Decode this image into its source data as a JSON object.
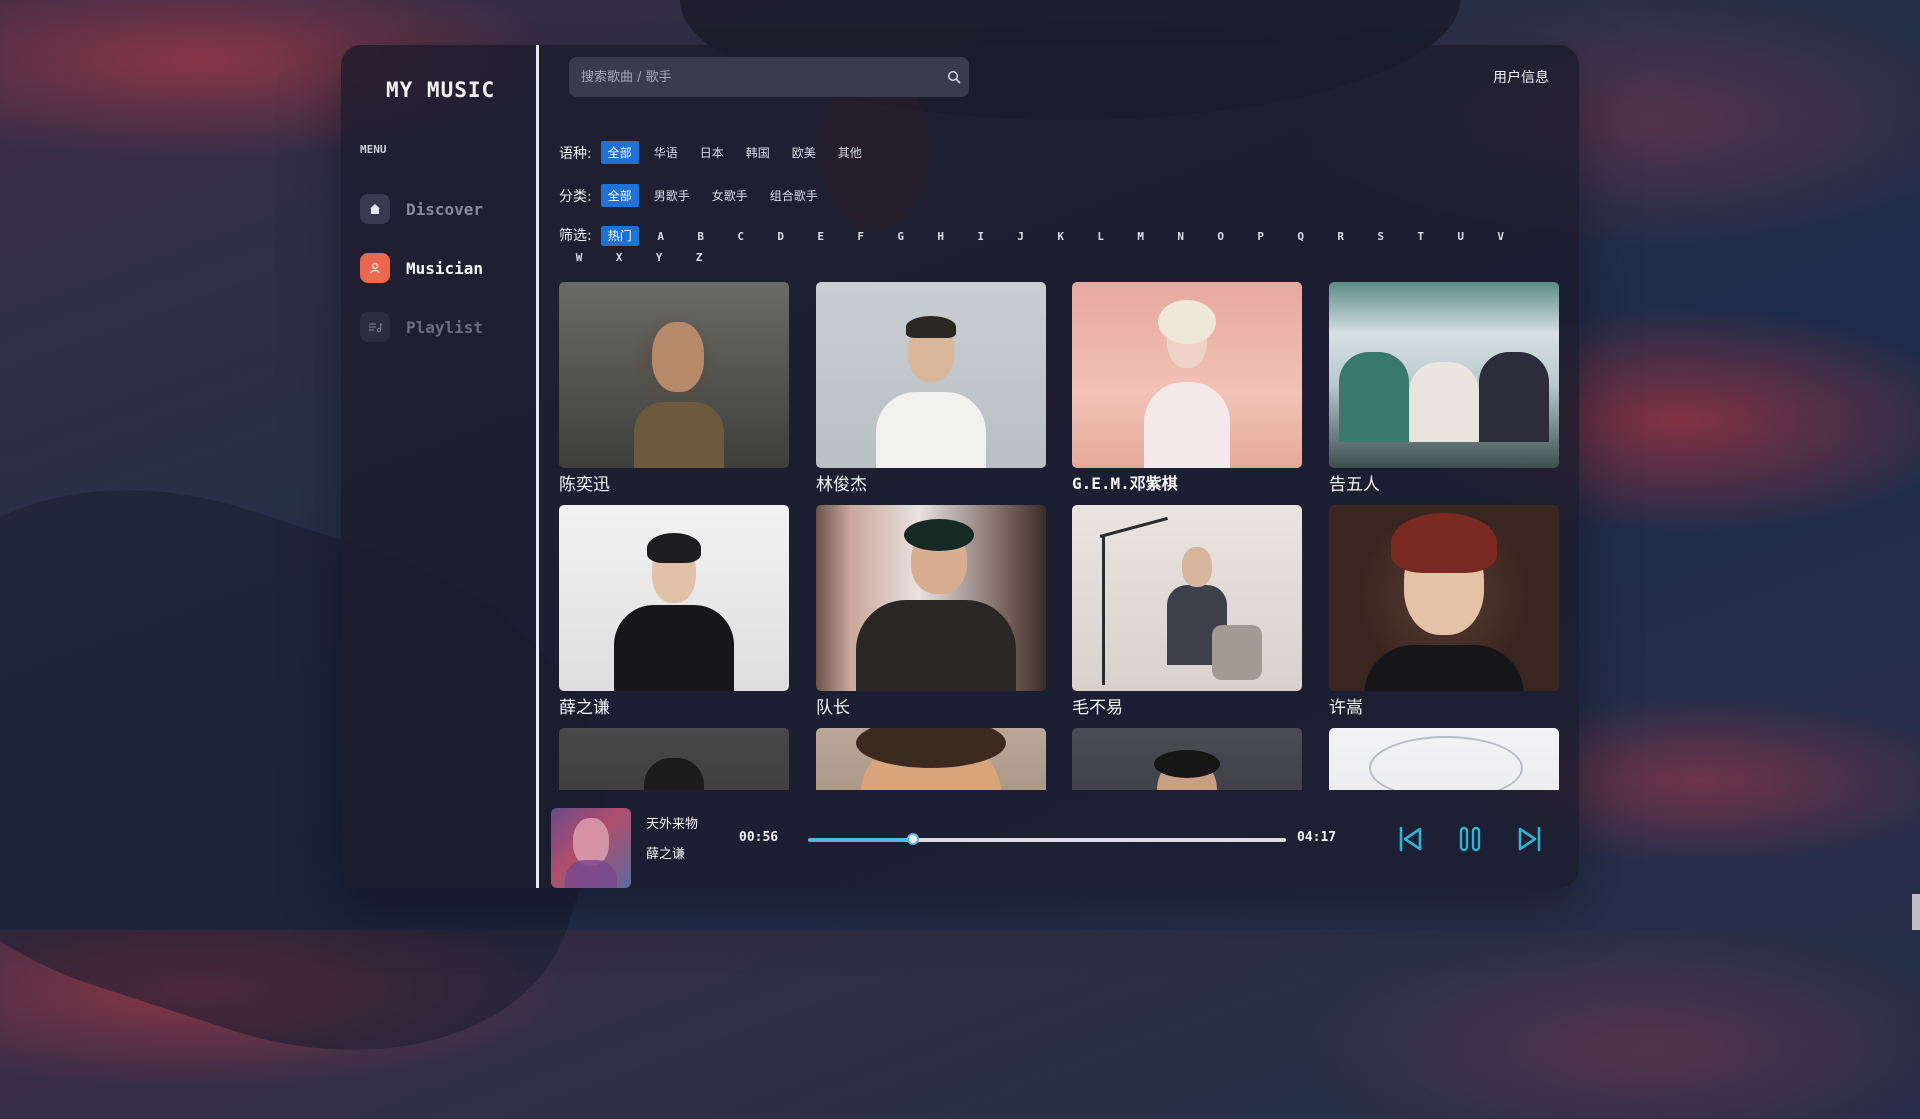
{
  "app": {
    "logo": "MY MUSIC",
    "menu_title": "MENU"
  },
  "sidebar": {
    "items": [
      {
        "label": "Discover",
        "icon": "home-icon",
        "state": "dim"
      },
      {
        "label": "Musician",
        "icon": "user-icon",
        "state": "active"
      },
      {
        "label": "Playlist",
        "icon": "playlist-icon",
        "state": "faint"
      }
    ]
  },
  "header": {
    "search_placeholder": "搜索歌曲 / 歌手",
    "user_info": "用户信息"
  },
  "filters": {
    "language": {
      "label": "语种:",
      "options": [
        "全部",
        "华语",
        "日本",
        "韩国",
        "欧美",
        "其他"
      ],
      "selected": "全部"
    },
    "category": {
      "label": "分类:",
      "options": [
        "全部",
        "男歌手",
        "女歌手",
        "组合歌手"
      ],
      "selected": "全部"
    },
    "index": {
      "label": "筛选:",
      "hot": "热门",
      "letters": [
        "A",
        "B",
        "C",
        "D",
        "E",
        "F",
        "G",
        "H",
        "I",
        "J",
        "K",
        "L",
        "M",
        "N",
        "O",
        "P",
        "Q",
        "R",
        "S",
        "T",
        "U",
        "V",
        "W",
        "X",
        "Y",
        "Z"
      ]
    }
  },
  "artists": [
    "陈奕迅",
    "林俊杰",
    "G.E.M.邓紫棋",
    "告五人",
    "薛之谦",
    "队长",
    "毛不易",
    "许嵩"
  ],
  "player": {
    "title": "天外来物",
    "artist": "薛之谦",
    "current_time": "00:56",
    "total_time": "04:17",
    "progress": 0.22
  },
  "colors": {
    "accent_blue": "#1e72d6",
    "active_nav": "#e8694f",
    "progress": "#5cb8e0",
    "controls": "#2fb3d6"
  }
}
